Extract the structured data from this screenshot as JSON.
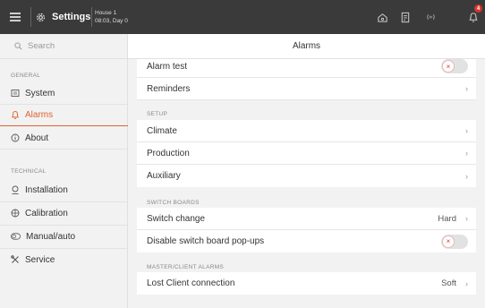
{
  "topbar": {
    "settings_label": "Settings",
    "house_name": "House 1",
    "house_time": "08:03, Day 0",
    "notification_count": "4",
    "icons": [
      "menu-icon",
      "settings-gear-icon",
      "home-icon",
      "document-icon",
      "signal-icon",
      "bell-icon"
    ]
  },
  "sidebar": {
    "search_placeholder": "Search",
    "general_header": "GENERAL",
    "technical_header": "TECHNICAL",
    "items": [
      {
        "label": "System",
        "icon": "system-icon"
      },
      {
        "label": "Alarms",
        "icon": "bell-icon",
        "active": true
      },
      {
        "label": "About",
        "icon": "info-icon"
      },
      {
        "label": "Installation",
        "icon": "installation-icon"
      },
      {
        "label": "Calibration",
        "icon": "calibration-icon"
      },
      {
        "label": "Manual/auto",
        "icon": "manual-auto-icon"
      },
      {
        "label": "Service",
        "icon": "service-icon"
      }
    ]
  },
  "main": {
    "title": "Alarms",
    "rows_top": [
      {
        "label": "Alarm test",
        "control": "toggle",
        "on": false
      },
      {
        "label": "Reminders",
        "control": "chevron"
      }
    ],
    "setup_header": "SETUP",
    "setup_rows": [
      {
        "label": "Climate"
      },
      {
        "label": "Production"
      },
      {
        "label": "Auxiliary"
      }
    ],
    "switch_header": "SWITCH BOARDS",
    "switch_rows": [
      {
        "label": "Switch change",
        "value": "Hard",
        "control": "chevron"
      },
      {
        "label": "Disable switch board pop-ups",
        "control": "toggle",
        "on": false
      }
    ],
    "master_header": "MASTER/CLIENT ALARMS",
    "master_rows": [
      {
        "label": "Lost Client connection",
        "value": "Soft",
        "control": "chevron"
      }
    ],
    "toggle_off_symbol": "×",
    "chevron_symbol": "›"
  },
  "colors": {
    "topbar_bg": "#3a3a3a",
    "accent": "#e0612f",
    "badge": "#d9352b"
  }
}
